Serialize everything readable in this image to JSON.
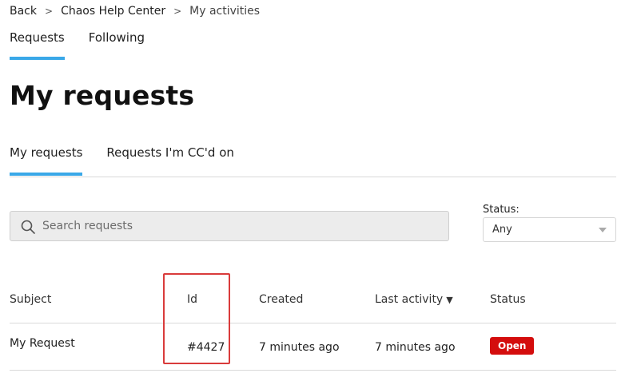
{
  "breadcrumb": {
    "items": [
      "Back",
      "Chaos Help Center",
      "My activities"
    ],
    "separator": ">"
  },
  "top_tabs": [
    {
      "label": "Requests",
      "active": true
    },
    {
      "label": "Following",
      "active": false
    }
  ],
  "page_title": "My requests",
  "sub_tabs": [
    {
      "label": "My requests",
      "active": true
    },
    {
      "label": "Requests I'm CC'd on",
      "active": false
    }
  ],
  "search": {
    "placeholder": "Search requests",
    "value": "",
    "icon": "search-icon"
  },
  "status_filter": {
    "label": "Status:",
    "selected": "Any"
  },
  "table": {
    "columns": [
      "Subject",
      "Id",
      "Created",
      "Last activity",
      "Status"
    ],
    "sort_indicator": "▼",
    "rows": [
      {
        "subject": "My Request",
        "id": "#4427",
        "created": "7 minutes ago",
        "last_activity": "7 minutes ago",
        "status": "Open"
      }
    ]
  },
  "colors": {
    "accent": "#3aa8e8",
    "status_open": "#d40d0d",
    "highlight": "#d93b3b"
  }
}
